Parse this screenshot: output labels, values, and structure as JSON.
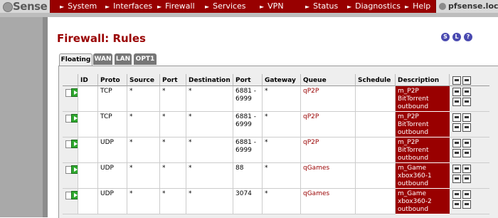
{
  "app": {
    "logo": "Sense",
    "hostname": "pfsense.local"
  },
  "nav": [
    "System",
    "Interfaces",
    "Firewall",
    "Services",
    "VPN",
    "Status",
    "Diagnostics",
    "Help"
  ],
  "page": {
    "title": "Firewall: Rules"
  },
  "header_icons": [
    "S",
    "L",
    "?"
  ],
  "tabs": [
    "Floating",
    "WAN",
    "LAN",
    "OPT1"
  ],
  "table": {
    "columns": [
      "ID",
      "Proto",
      "Source",
      "Port",
      "Destination",
      "Port",
      "Gateway",
      "Queue",
      "Schedule",
      "Description"
    ],
    "rows": [
      {
        "id": "",
        "proto": "TCP",
        "source": "*",
        "sport": "*",
        "dest": "*",
        "dport": "6881 - 6999",
        "gateway": "*",
        "queue": "qP2P",
        "schedule": "",
        "desc": "m_P2P BitTorrent outbound"
      },
      {
        "id": "",
        "proto": "TCP",
        "source": "*",
        "sport": "*",
        "dest": "*",
        "dport": "6881 - 6999",
        "gateway": "*",
        "queue": "qP2P",
        "schedule": "",
        "desc": "m_P2P BitTorrent outbound"
      },
      {
        "id": "",
        "proto": "UDP",
        "source": "*",
        "sport": "*",
        "dest": "*",
        "dport": "6881 - 6999",
        "gateway": "*",
        "queue": "qP2P",
        "schedule": "",
        "desc": "m_P2P BitTorrent outbound"
      },
      {
        "id": "",
        "proto": "UDP",
        "source": "*",
        "sport": "*",
        "dest": "*",
        "dport": "88",
        "gateway": "*",
        "queue": "qGames",
        "schedule": "",
        "desc": "m_Game xbox360-1 outbound"
      },
      {
        "id": "",
        "proto": "UDP",
        "source": "*",
        "sport": "*",
        "dest": "*",
        "dport": "3074",
        "gateway": "*",
        "queue": "qGames",
        "schedule": "",
        "desc": "m_Game xbox360-2 outbound"
      }
    ]
  },
  "colors": {
    "nav_bar": "#990000",
    "description_bg": "#990000",
    "queue_text": "#990000",
    "pass_icon": "#2fa82f"
  }
}
